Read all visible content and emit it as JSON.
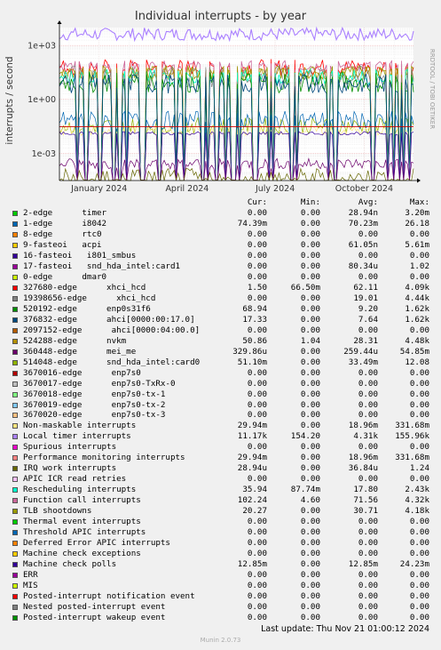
{
  "chart_data": {
    "type": "line",
    "title": "Individual interrupts - by year",
    "ylabel": "interrupts / second",
    "yscale": "log",
    "ylim": [
      3e-05,
      10000
    ],
    "xlim": [
      "2023-11-21",
      "2024-11-21"
    ],
    "y_ticks": [
      {
        "label": "1e+03",
        "value": 1000
      },
      {
        "label": "1e+00",
        "value": 1
      },
      {
        "label": "1e-03",
        "value": 0.001
      }
    ],
    "x_ticks": [
      {
        "label": "January 2024",
        "value": "2024-01-01"
      },
      {
        "label": "April 2024",
        "value": "2024-04-01"
      },
      {
        "label": "July 2024",
        "value": "2024-07-01"
      },
      {
        "label": "October 2024",
        "value": "2024-10-01"
      }
    ],
    "grid": true,
    "red_line": 0.03
  },
  "side_label": "RRDTOOL / TOBI OETIKER",
  "legend_headers": {
    "cur": "Cur:",
    "min": "Min:",
    "avg": "Avg:",
    "max": "Max:"
  },
  "legend": [
    {
      "name": "2-edge      timer",
      "color": "#00cc00",
      "cur": "0.00",
      "min": "0.00",
      "avg": "28.94n",
      "max": "3.20m"
    },
    {
      "name": "1-edge      i8042",
      "color": "#0066b3",
      "cur": "74.39m",
      "min": "0.00",
      "avg": "70.23m",
      "max": "26.18"
    },
    {
      "name": "8-edge      rtc0",
      "color": "#ff8000",
      "cur": "0.00",
      "min": "0.00",
      "avg": "0.00",
      "max": "0.00"
    },
    {
      "name": "9-fasteoi   acpi",
      "color": "#ffcc00",
      "cur": "0.00",
      "min": "0.00",
      "avg": "61.05n",
      "max": "5.61m"
    },
    {
      "name": "16-fasteoi   i801_smbus",
      "color": "#330099",
      "cur": "0.00",
      "min": "0.00",
      "avg": "0.00",
      "max": "0.00"
    },
    {
      "name": "17-fasteoi   snd_hda_intel:card1",
      "color": "#990099",
      "cur": "0.00",
      "min": "0.00",
      "avg": "80.34u",
      "max": "1.02"
    },
    {
      "name": "0-edge      dmar0",
      "color": "#ccff00",
      "cur": "0.00",
      "min": "0.00",
      "avg": "0.00",
      "max": "0.00"
    },
    {
      "name": "327680-edge      xhci_hcd",
      "color": "#ff0000",
      "cur": "1.50",
      "min": "66.50m",
      "avg": "62.11",
      "max": "4.09k"
    },
    {
      "name": "19398656-edge      xhci_hcd",
      "color": "#808080",
      "cur": "0.00",
      "min": "0.00",
      "avg": "19.01",
      "max": "4.44k"
    },
    {
      "name": "520192-edge      enp0s31f6",
      "color": "#008f00",
      "cur": "68.94",
      "min": "0.00",
      "avg": "9.20",
      "max": "1.62k"
    },
    {
      "name": "376832-edge      ahci[0000:00:17.0]",
      "color": "#00487d",
      "cur": "17.33",
      "min": "0.00",
      "avg": "7.64",
      "max": "1.62k"
    },
    {
      "name": "2097152-edge      ahci[0000:04:00.0]",
      "color": "#b35a00",
      "cur": "0.00",
      "min": "0.00",
      "avg": "0.00",
      "max": "0.00"
    },
    {
      "name": "524288-edge      nvkm",
      "color": "#b38f00",
      "cur": "50.86",
      "min": "1.04",
      "avg": "28.31",
      "max": "4.48k"
    },
    {
      "name": "360448-edge      mei_me",
      "color": "#6b006b",
      "cur": "329.86u",
      "min": "0.00",
      "avg": "259.44u",
      "max": "54.85m"
    },
    {
      "name": "514048-edge      snd_hda_intel:card0",
      "color": "#8fb300",
      "cur": "51.10m",
      "min": "0.00",
      "avg": "33.49m",
      "max": "12.08"
    },
    {
      "name": "3670016-edge      enp7s0",
      "color": "#b30000",
      "cur": "0.00",
      "min": "0.00",
      "avg": "0.00",
      "max": "0.00"
    },
    {
      "name": "3670017-edge      enp7s0-TxRx-0",
      "color": "#bebebe",
      "cur": "0.00",
      "min": "0.00",
      "avg": "0.00",
      "max": "0.00"
    },
    {
      "name": "3670018-edge      enp7s0-tx-1",
      "color": "#80ff80",
      "cur": "0.00",
      "min": "0.00",
      "avg": "0.00",
      "max": "0.00"
    },
    {
      "name": "3670019-edge      enp7s0-tx-2",
      "color": "#80c9ff",
      "cur": "0.00",
      "min": "0.00",
      "avg": "0.00",
      "max": "0.00"
    },
    {
      "name": "3670020-edge      enp7s0-tx-3",
      "color": "#ffc080",
      "cur": "0.00",
      "min": "0.00",
      "avg": "0.00",
      "max": "0.00"
    },
    {
      "name": "Non-maskable interrupts",
      "color": "#ffe680",
      "cur": "29.94m",
      "min": "0.00",
      "avg": "18.96m",
      "max": "331.68m"
    },
    {
      "name": "Local timer interrupts",
      "color": "#aa80ff",
      "cur": "11.17k",
      "min": "154.20",
      "avg": "4.31k",
      "max": "155.96k"
    },
    {
      "name": "Spurious interrupts",
      "color": "#ee00cc",
      "cur": "0.00",
      "min": "0.00",
      "avg": "0.00",
      "max": "0.00"
    },
    {
      "name": "Performance monitoring interrupts",
      "color": "#ff8080",
      "cur": "29.94m",
      "min": "0.00",
      "avg": "18.96m",
      "max": "331.68m"
    },
    {
      "name": "IRQ work interrupts",
      "color": "#666600",
      "cur": "28.94u",
      "min": "0.00",
      "avg": "36.84u",
      "max": "1.24"
    },
    {
      "name": "APIC ICR read retries",
      "color": "#ffbfff",
      "cur": "0.00",
      "min": "0.00",
      "avg": "0.00",
      "max": "0.00"
    },
    {
      "name": "Rescheduling interrupts",
      "color": "#00ffcc",
      "cur": "35.94",
      "min": "87.74m",
      "avg": "17.80",
      "max": "2.43k"
    },
    {
      "name": "Function call interrupts",
      "color": "#cc6699",
      "cur": "102.24",
      "min": "4.60",
      "avg": "71.56",
      "max": "4.32k"
    },
    {
      "name": "TLB shootdowns",
      "color": "#999900",
      "cur": "20.27",
      "min": "0.00",
      "avg": "30.71",
      "max": "4.18k"
    },
    {
      "name": "Thermal event interrupts",
      "color": "#00cc00",
      "cur": "0.00",
      "min": "0.00",
      "avg": "0.00",
      "max": "0.00"
    },
    {
      "name": "Threshold APIC interrupts",
      "color": "#0066b3",
      "cur": "0.00",
      "min": "0.00",
      "avg": "0.00",
      "max": "0.00"
    },
    {
      "name": "Deferred Error APIC interrupts",
      "color": "#ff8000",
      "cur": "0.00",
      "min": "0.00",
      "avg": "0.00",
      "max": "0.00"
    },
    {
      "name": "Machine check exceptions",
      "color": "#ffcc00",
      "cur": "0.00",
      "min": "0.00",
      "avg": "0.00",
      "max": "0.00"
    },
    {
      "name": "Machine check polls",
      "color": "#330099",
      "cur": "12.85m",
      "min": "0.00",
      "avg": "12.85m",
      "max": "24.23m"
    },
    {
      "name": "ERR",
      "color": "#990099",
      "cur": "0.00",
      "min": "0.00",
      "avg": "0.00",
      "max": "0.00"
    },
    {
      "name": "MIS",
      "color": "#ccff00",
      "cur": "0.00",
      "min": "0.00",
      "avg": "0.00",
      "max": "0.00"
    },
    {
      "name": "Posted-interrupt notification event",
      "color": "#ff0000",
      "cur": "0.00",
      "min": "0.00",
      "avg": "0.00",
      "max": "0.00"
    },
    {
      "name": "Nested posted-interrupt event",
      "color": "#808080",
      "cur": "0.00",
      "min": "0.00",
      "avg": "0.00",
      "max": "0.00"
    },
    {
      "name": "Posted-interrupt wakeup event",
      "color": "#008f00",
      "cur": "0.00",
      "min": "0.00",
      "avg": "0.00",
      "max": "0.00"
    }
  ],
  "last_update": "Last update: Thu Nov 21 01:00:12 2024",
  "footer": "Munin 2.0.73"
}
